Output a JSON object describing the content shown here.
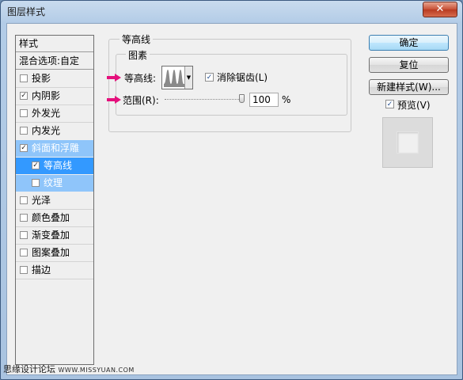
{
  "window": {
    "title": "图层样式",
    "close_glyph": "✕"
  },
  "sidebar": {
    "header": "样式",
    "blend_options": "混合选项:自定",
    "items": [
      {
        "label": "投影",
        "checked": false
      },
      {
        "label": "内阴影",
        "checked": true
      },
      {
        "label": "外发光",
        "checked": false
      },
      {
        "label": "内发光",
        "checked": false
      },
      {
        "label": "斜面和浮雕",
        "checked": true,
        "selected": true
      },
      {
        "label": "等高线",
        "checked": true,
        "selected": true
      },
      {
        "label": "纹理",
        "checked": false
      },
      {
        "label": "光泽",
        "checked": false
      },
      {
        "label": "颜色叠加",
        "checked": false
      },
      {
        "label": "渐变叠加",
        "checked": false
      },
      {
        "label": "图案叠加",
        "checked": false
      },
      {
        "label": "描边",
        "checked": false
      }
    ],
    "checkmark": "✓"
  },
  "panel": {
    "group_title": "等高线",
    "subgroup_title": "图素",
    "contour_label": "等高线:",
    "antialias_label": "消除锯齿(L)",
    "antialias_checked": true,
    "range_label": "范围(R):",
    "range_value": "100",
    "range_fraction": 1.0,
    "range_unit": "%"
  },
  "buttons": {
    "ok": "确定",
    "reset": "复位",
    "new_style": "新建样式(W)...",
    "preview_label": "预览(V)",
    "preview_checked": true
  },
  "colors": {
    "accent": "#3399ff",
    "arrow": "#e5107c"
  },
  "watermark": {
    "cn": "思缘设计论坛",
    "en": "WWW.MISSYUAN.COM"
  }
}
